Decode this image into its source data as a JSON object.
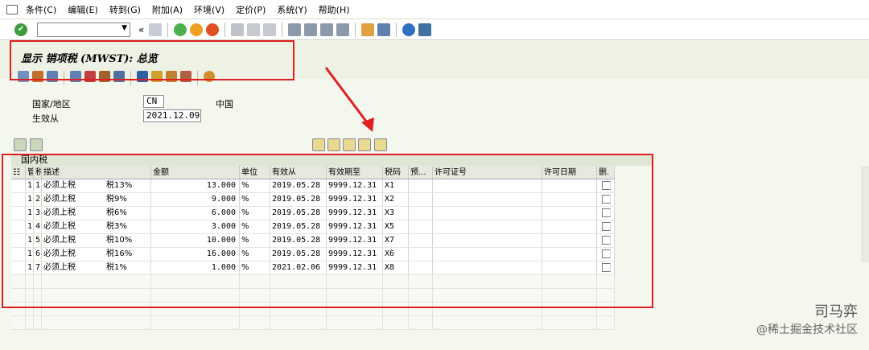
{
  "menubar": {
    "items": [
      "条件(C)",
      "编辑(E)",
      "转到(G)",
      "附加(A)",
      "环境(V)",
      "定价(P)",
      "系统(Y)",
      "帮助(H)"
    ]
  },
  "toolbar": {
    "command_value": "",
    "nav_back": "«"
  },
  "title": "显示 销项税 (MWST): 总览",
  "fields": {
    "country_label": "国家/地区",
    "country_value": "CN",
    "country_name": "中国",
    "valid_from_label": "生效从",
    "valid_from_value": "2021.12.09"
  },
  "section": {
    "title": "国内税"
  },
  "grid": {
    "columns": [
      "管",
      "税",
      "描述",
      "金额",
      "单位",
      "有效从",
      "有效期至",
      "税码",
      "预...",
      "许可证号",
      "许可日期",
      "删."
    ],
    "rows": [
      {
        "c1": "1",
        "c2": "1",
        "desc": "必须上税",
        "rate": "税13%",
        "amount": "13.000",
        "unit": "%",
        "from": "2019.05.28",
        "to": "9999.12.31",
        "code": "X1"
      },
      {
        "c1": "1",
        "c2": "2",
        "desc": "必须上税",
        "rate": "税9%",
        "amount": "9.000",
        "unit": "%",
        "from": "2019.05.28",
        "to": "9999.12.31",
        "code": "X2"
      },
      {
        "c1": "1",
        "c2": "3",
        "desc": "必须上税",
        "rate": "税6%",
        "amount": "6.000",
        "unit": "%",
        "from": "2019.05.28",
        "to": "9999.12.31",
        "code": "X3"
      },
      {
        "c1": "1",
        "c2": "4",
        "desc": "必须上税",
        "rate": "税3%",
        "amount": "3.000",
        "unit": "%",
        "from": "2019.05.28",
        "to": "9999.12.31",
        "code": "X5"
      },
      {
        "c1": "1",
        "c2": "5",
        "desc": "必须上税",
        "rate": "税10%",
        "amount": "10.000",
        "unit": "%",
        "from": "2019.05.28",
        "to": "9999.12.31",
        "code": "X7"
      },
      {
        "c1": "1",
        "c2": "6",
        "desc": "必须上税",
        "rate": "税16%",
        "amount": "16.000",
        "unit": "%",
        "from": "2019.05.28",
        "to": "9999.12.31",
        "code": "X6"
      },
      {
        "c1": "1",
        "c2": "7",
        "desc": "必须上税",
        "rate": "税1%",
        "amount": "1.000",
        "unit": "%",
        "from": "2021.02.06",
        "to": "9999.12.31",
        "code": "X8"
      }
    ]
  },
  "watermark": {
    "name": "司马弈",
    "sub": "@稀土掘金技术社区"
  },
  "colors": {
    "highlight_red": "#e02020",
    "ok_green": "#3a9c3a"
  }
}
